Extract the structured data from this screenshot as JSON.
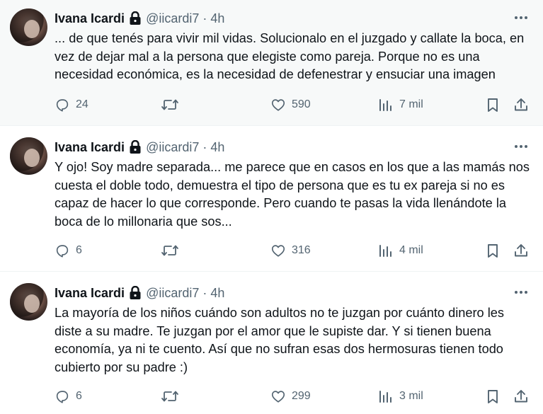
{
  "tweets": [
    {
      "author": "Ivana Icardi",
      "handle": "@iicardi7",
      "separator": "·",
      "time": "4h",
      "text": "... de que tenés para vivir mil vidas. Solucionalo en el juzgado y callate la boca, en vez de dejar mal a la persona que elegiste como pareja. Porque no es una necesidad económica, es la necesidad de defenestrar y ensuciar una imagen",
      "replies": "24",
      "likes": "590",
      "views": "7 mil"
    },
    {
      "author": "Ivana Icardi",
      "handle": "@iicardi7",
      "separator": "·",
      "time": "4h",
      "text": "Y ojo! Soy madre separada... me parece que en casos en los que a las mamás nos cuesta el doble todo, demuestra el tipo de persona que es tu ex pareja si no es capaz de hacer lo que corresponde. Pero cuando te pasas la vida llenándote la boca de lo millonaria que sos...",
      "replies": "6",
      "likes": "316",
      "views": "4 mil"
    },
    {
      "author": "Ivana Icardi",
      "handle": "@iicardi7",
      "separator": "·",
      "time": "4h",
      "text": "La mayoría de los niños cuándo son adultos no te juzgan por cuánto dinero les diste a su madre. Te juzgan por el amor que le supiste dar. Y si tienen buena economía, ya ni te cuento. Así que no sufran esas dos hermosuras tienen todo cubierto por su padre :)",
      "replies": "6",
      "likes": "299",
      "views": "3 mil"
    }
  ],
  "icons": {
    "lock": "lock-icon",
    "more": "more-icon",
    "reply": "reply-icon",
    "retweet": "retweet-icon",
    "like": "heart-icon",
    "views": "views-icon",
    "bookmark": "bookmark-icon",
    "share": "share-icon"
  },
  "colors": {
    "text": "#0f1419",
    "muted": "#536471",
    "highlight_bg": "#f7f9f9"
  }
}
